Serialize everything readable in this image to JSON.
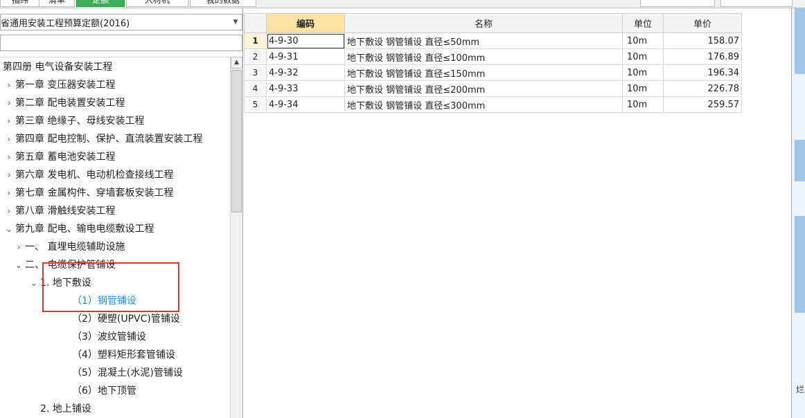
{
  "top_tabs": [
    {
      "label": "插纬",
      "active": false
    },
    {
      "label": "清单",
      "active": false
    },
    {
      "label": "定额",
      "active": true
    },
    {
      "label": "人材机",
      "active": false
    },
    {
      "label": "我的数据",
      "active": false
    }
  ],
  "left_panel": {
    "quota_select": "省通用安装工程预算定额(2016)",
    "search": {
      "value": "",
      "placeholder": ""
    },
    "tree": [
      {
        "label": "第四册 电气设备安装工程",
        "toggle": "",
        "depth": 0
      },
      {
        "label": "第一章 变压器安装工程",
        "toggle": ">",
        "depth": 1
      },
      {
        "label": "第二章 配电装置安装工程",
        "toggle": ">",
        "depth": 1
      },
      {
        "label": "第三章 绝缘子、母线安装工程",
        "toggle": ">",
        "depth": 1
      },
      {
        "label": "第四章 配电控制、保护、直流装置安装工程",
        "toggle": ">",
        "depth": 1
      },
      {
        "label": "第五章 蓄电池安装工程",
        "toggle": ">",
        "depth": 1
      },
      {
        "label": "第六章 发电机、电动机检查接线工程",
        "toggle": ">",
        "depth": 1
      },
      {
        "label": "第七章 金属构件、穿墙套板安装工程",
        "toggle": ">",
        "depth": 1
      },
      {
        "label": "第八章 滑触线安装工程",
        "toggle": ">",
        "depth": 1
      },
      {
        "label": "第九章 配电、输电电缆敷设工程",
        "toggle": "v",
        "depth": 1
      },
      {
        "label": "一、 直埋电缆辅助设施",
        "toggle": ">",
        "depth": 2
      },
      {
        "label": "二、 电缆保护管铺设",
        "toggle": "v",
        "depth": 2
      },
      {
        "label": "1. 地下敷设",
        "toggle": "v",
        "depth": 3
      },
      {
        "label": "（1）钢管铺设",
        "toggle": "",
        "depth": 4,
        "selected": true
      },
      {
        "label": "（2）硬塑(UPVC)管铺设",
        "toggle": "",
        "depth": 4
      },
      {
        "label": "（3）波纹管铺设",
        "toggle": "",
        "depth": 4
      },
      {
        "label": "（4）塑料矩形套管铺设",
        "toggle": "",
        "depth": 4
      },
      {
        "label": "（5）混凝土(水泥)管铺设",
        "toggle": "",
        "depth": 4
      },
      {
        "label": "（6）地下顶管",
        "toggle": "",
        "depth": 4
      },
      {
        "label": "2. 地上铺设",
        "toggle": "",
        "depth": 3
      }
    ]
  },
  "grid": {
    "columns": {
      "code": "编码",
      "name": "名称",
      "unit": "单位",
      "price": "单价"
    },
    "rows": [
      {
        "n": "1",
        "code": "4-9-30",
        "name": "地下敷设 钢管铺设 直径≤50mm",
        "unit": "10m",
        "price": "158.07"
      },
      {
        "n": "2",
        "code": "4-9-31",
        "name": "地下敷设 钢管铺设 直径≤100mm",
        "unit": "10m",
        "price": "176.89"
      },
      {
        "n": "3",
        "code": "4-9-32",
        "name": "地下敷设 钢管铺设 直径≤150mm",
        "unit": "10m",
        "price": "196.34"
      },
      {
        "n": "4",
        "code": "4-9-33",
        "name": "地下敷设 钢管铺设 直径≤200mm",
        "unit": "10m",
        "price": "226.78"
      },
      {
        "n": "5",
        "code": "4-9-34",
        "name": "地下敷设 钢管铺设 直径≤300mm",
        "unit": "10m",
        "price": "259.57"
      }
    ]
  },
  "edge_glyph": "烂",
  "colors": {
    "active_tab": "#3cae5a",
    "selected_text": "#1e8ed6",
    "highlight": "#e23232",
    "code_header": "#fbe3a6"
  }
}
